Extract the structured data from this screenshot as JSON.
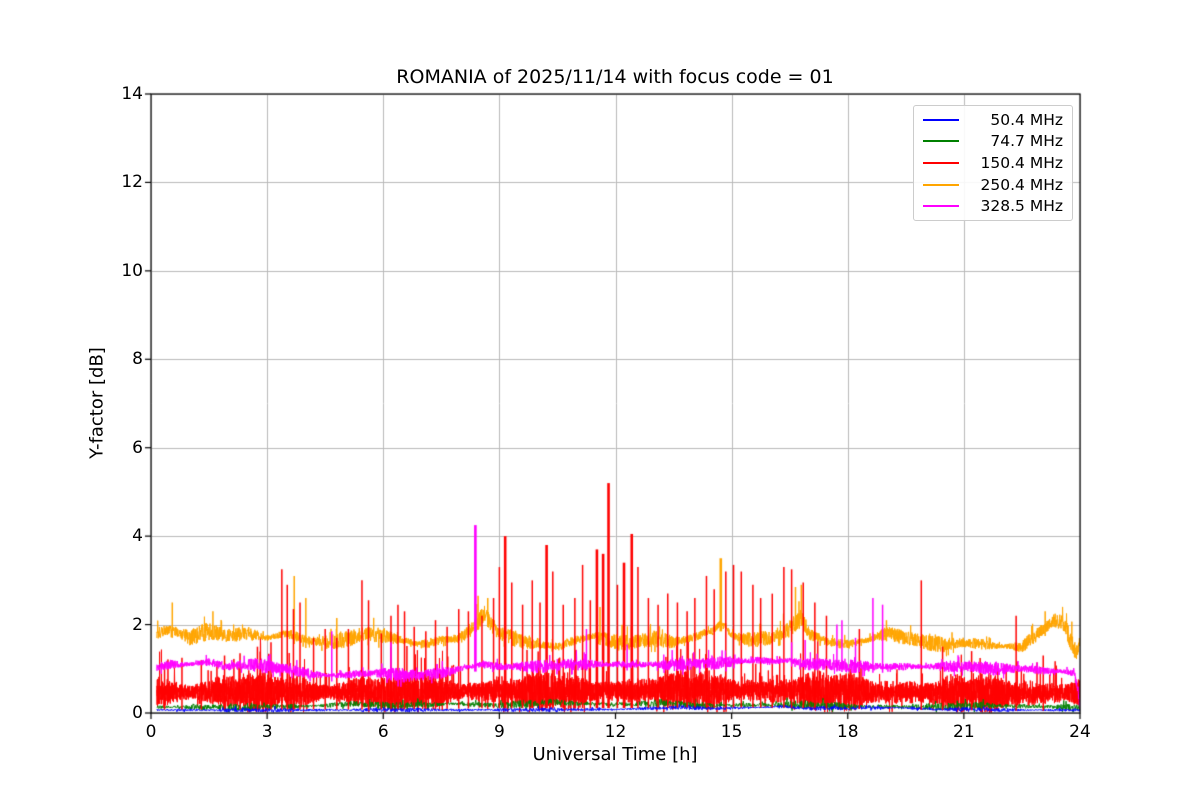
{
  "chart_data": {
    "type": "line",
    "title": "ROMANIA of 2025/11/14 with focus code = 01",
    "xlabel": "Universal Time [h]",
    "ylabel": "Y-factor [dB]",
    "xlim": [
      0,
      24
    ],
    "ylim": [
      0,
      14
    ],
    "xticks": [
      0,
      3,
      6,
      9,
      12,
      15,
      18,
      21,
      24
    ],
    "yticks": [
      0,
      2,
      4,
      6,
      8,
      10,
      12,
      14
    ],
    "grid": true,
    "grid_color": "#b8b8b8",
    "legend_position": "upper right",
    "x_start": 0.15,
    "series": [
      {
        "name": "50.4 MHz",
        "color": "#0000ff",
        "band_half_width": 0.045,
        "base": [
          [
            0.15,
            0.07
          ],
          [
            3,
            0.065
          ],
          [
            6,
            0.07
          ],
          [
            9,
            0.07
          ],
          [
            12,
            0.08
          ],
          [
            13.8,
            0.13
          ],
          [
            14.5,
            0.1
          ],
          [
            16.3,
            0.14
          ],
          [
            17,
            0.1
          ],
          [
            19.3,
            0.12
          ],
          [
            20,
            0.09
          ],
          [
            22,
            0.07
          ],
          [
            24,
            0.06
          ]
        ],
        "spikes": []
      },
      {
        "name": "74.7 MHz",
        "color": "#008000",
        "band_half_width": 0.08,
        "base": [
          [
            0.15,
            0.14
          ],
          [
            2,
            0.13
          ],
          [
            4,
            0.15
          ],
          [
            5.3,
            0.21
          ],
          [
            6,
            0.16
          ],
          [
            7.8,
            0.21
          ],
          [
            9,
            0.17
          ],
          [
            10.4,
            0.25
          ],
          [
            11,
            0.21
          ],
          [
            12,
            0.19
          ],
          [
            13.4,
            0.23
          ],
          [
            14,
            0.17
          ],
          [
            16.8,
            0.19
          ],
          [
            18,
            0.15
          ],
          [
            20,
            0.14
          ],
          [
            21.5,
            0.17
          ],
          [
            24,
            0.13
          ]
        ],
        "spikes": []
      },
      {
        "name": "150.4 MHz",
        "color": "#ff0000",
        "band_half_width": 0.39,
        "base": [
          [
            0.15,
            0.47
          ],
          [
            3,
            0.47
          ],
          [
            6,
            0.47
          ],
          [
            9,
            0.5
          ],
          [
            12,
            0.5
          ],
          [
            15,
            0.52
          ],
          [
            17,
            0.5
          ],
          [
            19,
            0.47
          ],
          [
            21,
            0.45
          ],
          [
            23,
            0.44
          ],
          [
            24,
            0.46
          ]
        ],
        "spikes": [
          [
            0.35,
            1.1
          ],
          [
            0.8,
            1.25
          ],
          [
            1.3,
            1.2
          ],
          [
            1.9,
            1.3
          ],
          [
            2.3,
            1.35
          ],
          [
            2.75,
            1.5
          ],
          [
            3.1,
            1.6
          ],
          [
            3.38,
            3.25
          ],
          [
            3.52,
            2.9
          ],
          [
            3.68,
            2.35
          ],
          [
            3.85,
            2.5
          ],
          [
            4.2,
            1.7
          ],
          [
            4.5,
            1.9
          ],
          [
            4.8,
            1.7
          ],
          [
            5.1,
            1.9
          ],
          [
            5.45,
            3.0
          ],
          [
            5.62,
            2.55
          ],
          [
            5.95,
            1.8
          ],
          [
            6.2,
            2.2
          ],
          [
            6.38,
            2.45
          ],
          [
            6.55,
            2.3
          ],
          [
            6.8,
            1.95
          ],
          [
            7.1,
            1.85
          ],
          [
            7.35,
            2.1
          ],
          [
            7.65,
            1.95
          ],
          [
            7.95,
            2.35
          ],
          [
            8.2,
            2.3
          ],
          [
            8.55,
            2.2
          ],
          [
            8.85,
            2.6
          ],
          [
            9.0,
            3.3
          ],
          [
            9.15,
            4.0
          ],
          [
            9.32,
            2.95
          ],
          [
            9.6,
            2.45
          ],
          [
            9.85,
            3.0
          ],
          [
            10.05,
            2.5
          ],
          [
            10.22,
            3.8
          ],
          [
            10.38,
            3.2
          ],
          [
            10.65,
            2.45
          ],
          [
            10.95,
            2.6
          ],
          [
            11.15,
            3.35
          ],
          [
            11.35,
            2.55
          ],
          [
            11.52,
            3.7
          ],
          [
            11.68,
            3.6
          ],
          [
            11.82,
            5.2
          ],
          [
            12.05,
            2.9
          ],
          [
            12.22,
            3.4
          ],
          [
            12.42,
            4.05
          ],
          [
            12.58,
            3.3
          ],
          [
            12.85,
            2.6
          ],
          [
            13.1,
            2.45
          ],
          [
            13.35,
            2.7
          ],
          [
            13.6,
            2.5
          ],
          [
            13.85,
            2.3
          ],
          [
            14.05,
            2.6
          ],
          [
            14.35,
            3.1
          ],
          [
            14.55,
            2.8
          ],
          [
            14.85,
            3.2
          ],
          [
            15.05,
            3.35
          ],
          [
            15.25,
            3.2
          ],
          [
            15.55,
            2.9
          ],
          [
            15.75,
            2.6
          ],
          [
            16.05,
            2.7
          ],
          [
            16.35,
            3.3
          ],
          [
            16.55,
            3.25
          ],
          [
            16.85,
            2.95
          ],
          [
            17.15,
            2.5
          ],
          [
            17.45,
            2.2
          ],
          [
            18.3,
            1.9
          ],
          [
            19.9,
            3.0
          ],
          [
            20.45,
            1.5
          ],
          [
            21.2,
            1.4
          ],
          [
            22.35,
            2.2
          ],
          [
            23.05,
            1.3
          ]
        ]
      },
      {
        "name": "250.4 MHz",
        "color": "#ffa500",
        "band_half_width": 0.18,
        "base": [
          [
            0.15,
            1.8
          ],
          [
            0.5,
            1.9
          ],
          [
            1,
            1.7
          ],
          [
            1.5,
            1.85
          ],
          [
            2,
            1.75
          ],
          [
            2.5,
            1.8
          ],
          [
            3,
            1.7
          ],
          [
            3.5,
            1.8
          ],
          [
            4,
            1.65
          ],
          [
            4.5,
            1.6
          ],
          [
            5,
            1.65
          ],
          [
            5.5,
            1.8
          ],
          [
            6,
            1.75
          ],
          [
            6.5,
            1.65
          ],
          [
            7,
            1.55
          ],
          [
            7.5,
            1.65
          ],
          [
            8,
            1.7
          ],
          [
            8.4,
            2.0
          ],
          [
            8.6,
            2.25
          ],
          [
            8.8,
            2.0
          ],
          [
            9,
            1.8
          ],
          [
            9.5,
            1.65
          ],
          [
            10,
            1.55
          ],
          [
            10.5,
            1.5
          ],
          [
            11,
            1.65
          ],
          [
            11.5,
            1.75
          ],
          [
            12,
            1.6
          ],
          [
            12.5,
            1.6
          ],
          [
            13,
            1.7
          ],
          [
            13.5,
            1.6
          ],
          [
            14,
            1.7
          ],
          [
            14.5,
            1.85
          ],
          [
            14.75,
            2.05
          ],
          [
            15,
            1.75
          ],
          [
            15.5,
            1.65
          ],
          [
            16,
            1.7
          ],
          [
            16.5,
            1.9
          ],
          [
            16.8,
            2.15
          ],
          [
            17,
            1.8
          ],
          [
            17.5,
            1.6
          ],
          [
            18,
            1.55
          ],
          [
            18.5,
            1.65
          ],
          [
            19,
            1.8
          ],
          [
            19.5,
            1.7
          ],
          [
            20,
            1.6
          ],
          [
            20.5,
            1.55
          ],
          [
            21,
            1.6
          ],
          [
            21.5,
            1.55
          ],
          [
            22,
            1.5
          ],
          [
            22.5,
            1.5
          ],
          [
            23,
            1.85
          ],
          [
            23.35,
            2.1
          ],
          [
            23.6,
            2.0
          ],
          [
            23.8,
            1.55
          ],
          [
            23.9,
            1.4
          ],
          [
            24,
            1.6
          ]
        ],
        "spikes": [
          [
            0.55,
            2.5
          ],
          [
            1.6,
            2.3
          ],
          [
            3.7,
            3.1
          ],
          [
            4.0,
            2.6
          ],
          [
            4.8,
            2.15
          ],
          [
            8.45,
            2.65
          ],
          [
            8.7,
            2.6
          ],
          [
            11.6,
            2.4
          ],
          [
            14.72,
            3.5
          ],
          [
            16.65,
            2.85
          ],
          [
            16.8,
            2.9
          ],
          [
            19.0,
            2.1
          ],
          [
            23.1,
            2.3
          ]
        ]
      },
      {
        "name": "328.5 MHz",
        "color": "#ff00ff",
        "band_half_width": 0.14,
        "base": [
          [
            0.15,
            1.05
          ],
          [
            0.5,
            1.1
          ],
          [
            1,
            1.1
          ],
          [
            1.5,
            1.15
          ],
          [
            2,
            1.05
          ],
          [
            2.5,
            1.1
          ],
          [
            3,
            1.05
          ],
          [
            3.5,
            1.0
          ],
          [
            4,
            0.9
          ],
          [
            4.5,
            0.85
          ],
          [
            5,
            0.85
          ],
          [
            5.5,
            0.9
          ],
          [
            6,
            0.9
          ],
          [
            6.5,
            0.85
          ],
          [
            7,
            0.85
          ],
          [
            7.5,
            0.9
          ],
          [
            8,
            1.0
          ],
          [
            8.5,
            1.1
          ],
          [
            9,
            1.05
          ],
          [
            10,
            1.05
          ],
          [
            11,
            1.1
          ],
          [
            12,
            1.1
          ],
          [
            13,
            1.1
          ],
          [
            14,
            1.1
          ],
          [
            15,
            1.15
          ],
          [
            15.7,
            1.2
          ],
          [
            16,
            1.15
          ],
          [
            16.5,
            1.2
          ],
          [
            17,
            1.1
          ],
          [
            17.5,
            1.1
          ],
          [
            18,
            1.05
          ],
          [
            19,
            1.05
          ],
          [
            20,
            1.05
          ],
          [
            21,
            1.05
          ],
          [
            22,
            1.0
          ],
          [
            22.7,
            1.0
          ],
          [
            23,
            0.95
          ],
          [
            23.5,
            0.95
          ],
          [
            23.85,
            0.9
          ],
          [
            23.95,
            0.5
          ],
          [
            24,
            0.05
          ]
        ],
        "spikes": [
          [
            4.67,
            1.85
          ],
          [
            6.2,
            1.6
          ],
          [
            8.38,
            4.25
          ],
          [
            11.25,
            1.9
          ],
          [
            12.3,
            1.55
          ],
          [
            16.55,
            1.6
          ],
          [
            16.9,
            1.65
          ],
          [
            17.72,
            2.0
          ],
          [
            17.85,
            2.1
          ],
          [
            18.2,
            1.7
          ],
          [
            18.65,
            2.6
          ],
          [
            18.9,
            2.45
          ]
        ]
      }
    ]
  }
}
